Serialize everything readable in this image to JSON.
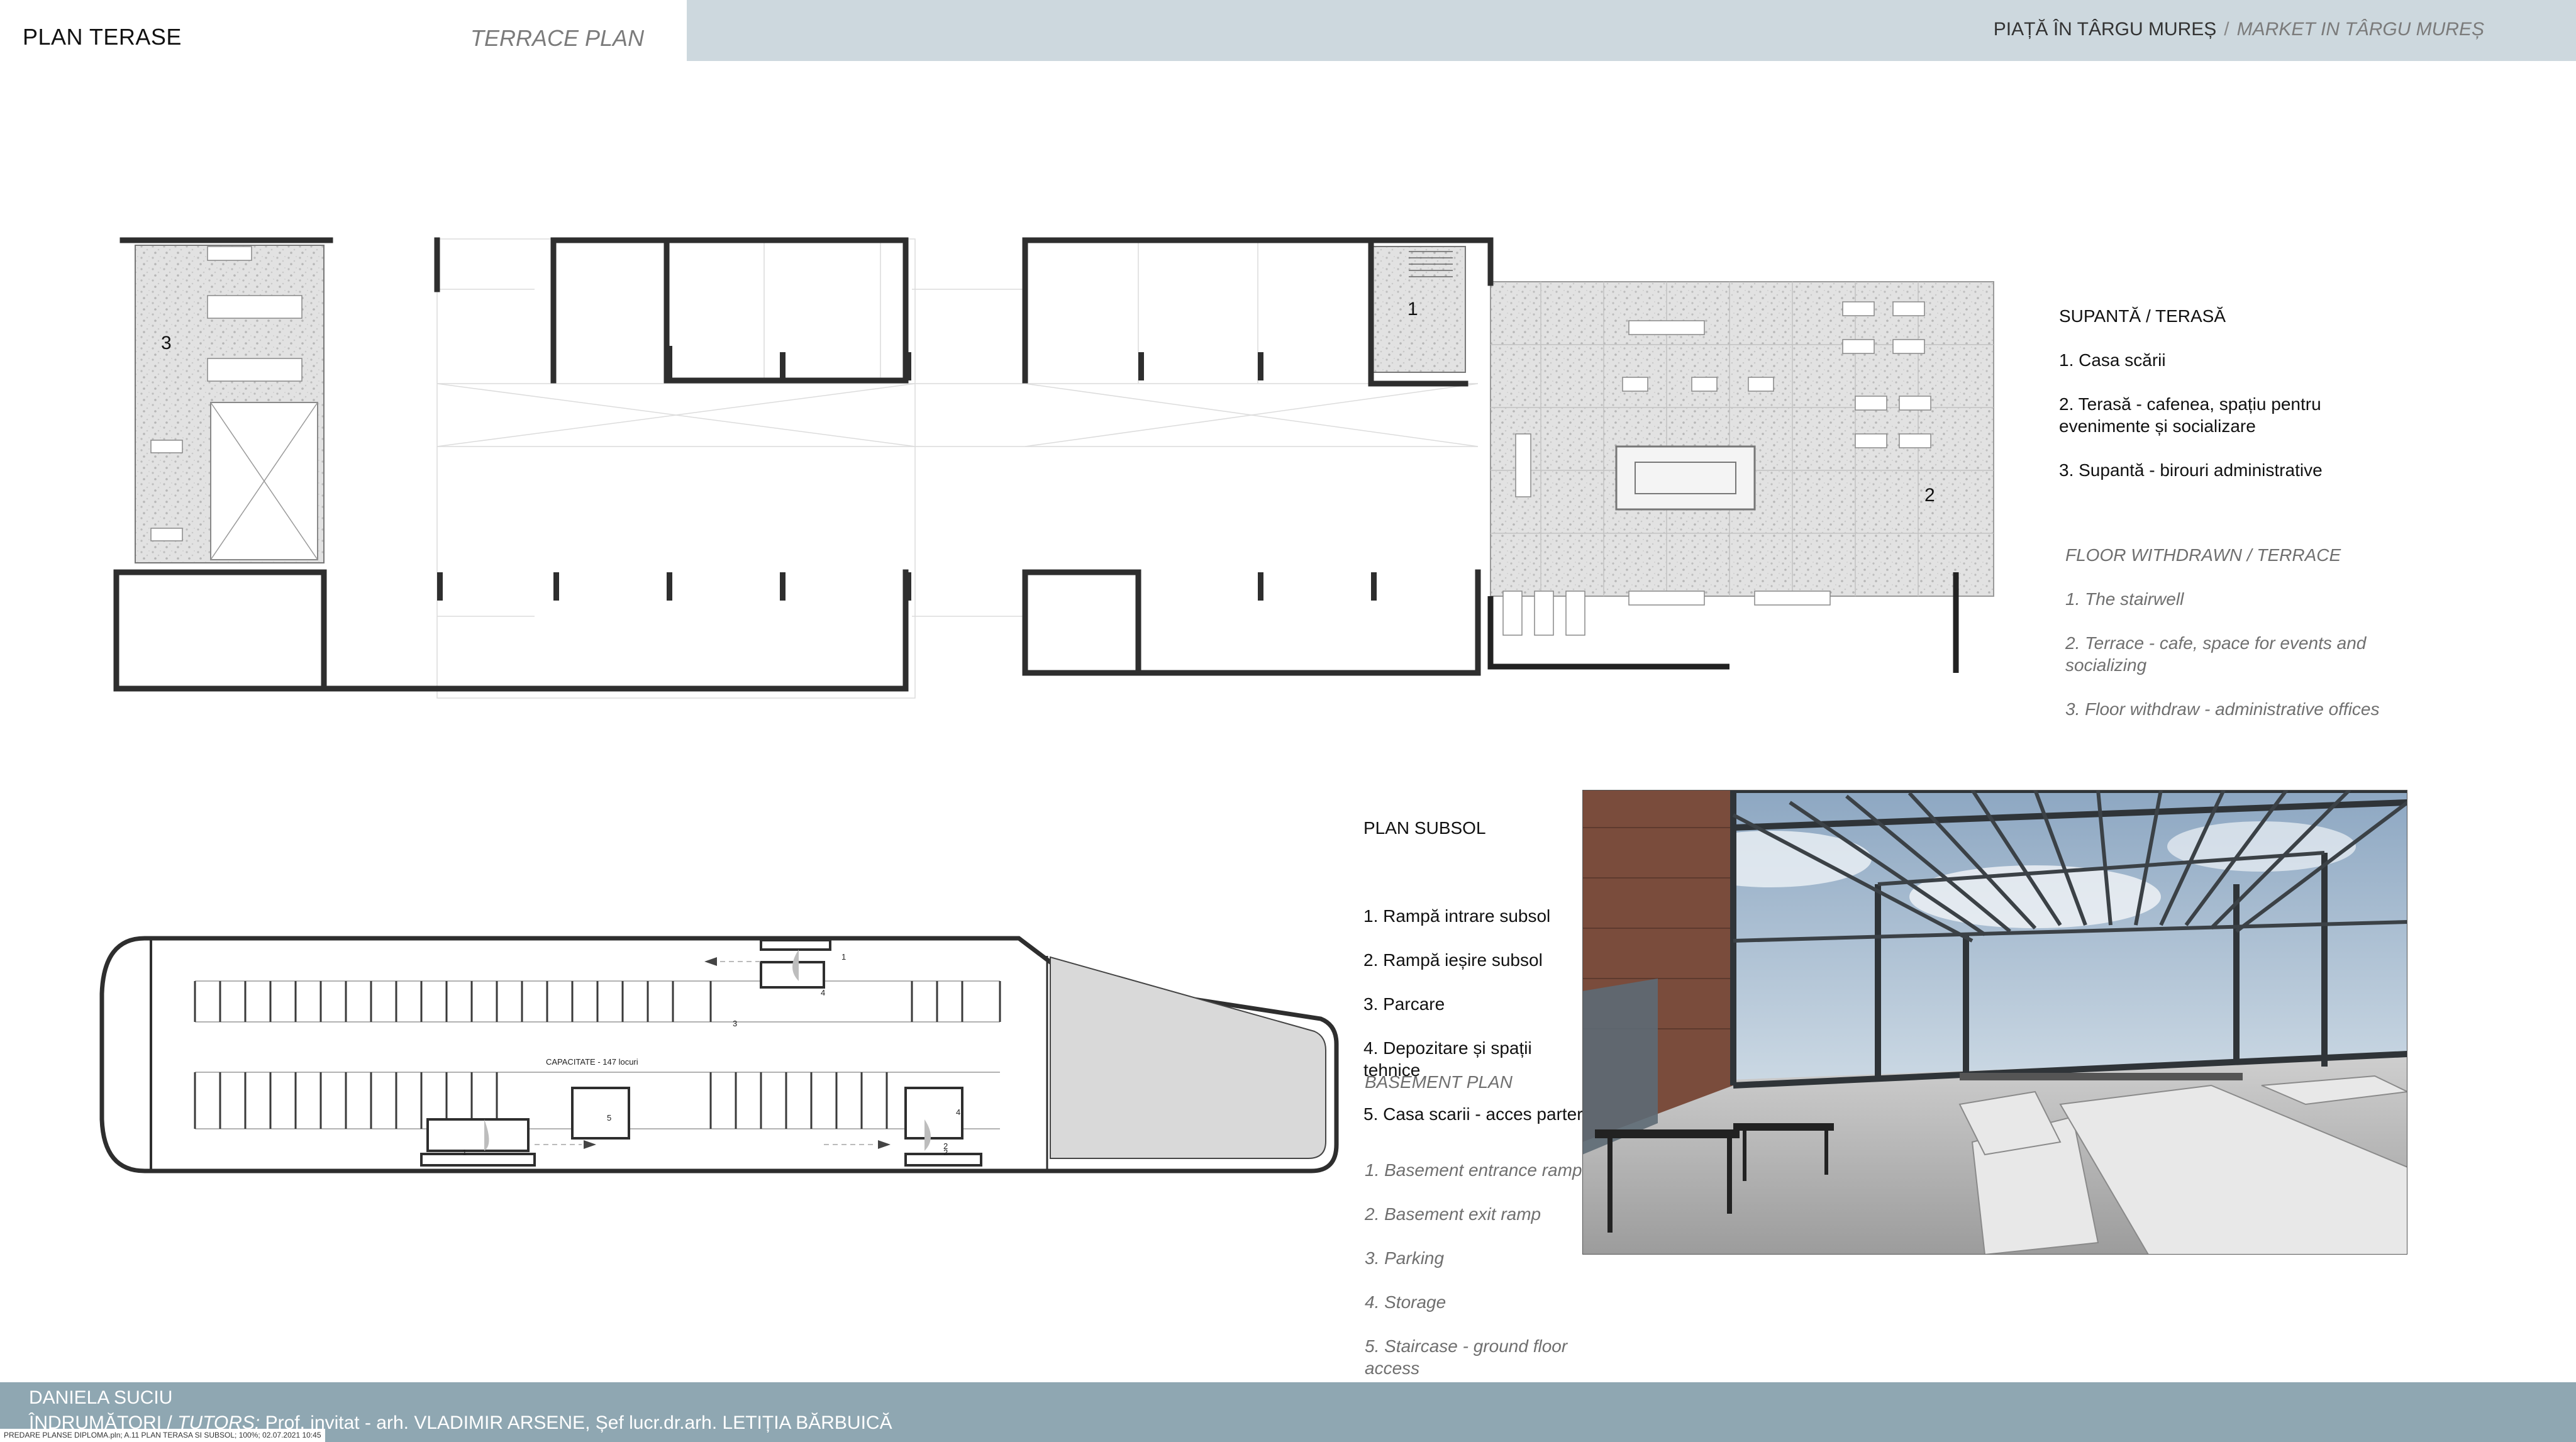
{
  "header": {
    "plan_title": "PLAN TERASE",
    "plan_title_en": "TERRACE PLAN",
    "project_ro": "PIAȚĂ ÎN TÂRGU MUREȘ",
    "project_sep": "/",
    "project_en": "MARKET IN TÂRGU MUREȘ"
  },
  "terrace_legend_ro": {
    "title": "SUPANTĂ / TERASĂ",
    "items": [
      "1.  Casa scării",
      "2. Terasă - cafenea, spațiu pentru\nevenimente și socializare",
      "3. Supantă - birouri administrative"
    ]
  },
  "terrace_legend_en": {
    "title": "FLOOR WITHDRAWN / TERRACE",
    "items": [
      "1. The stairwell",
      "2. Terrace - cafe, space for events and\nsocializing",
      "3. Floor withdraw  - administrative offices"
    ]
  },
  "basement_legend_ro": {
    "title": "PLAN SUBSOL",
    "items": [
      "1.  Rampă intrare subsol",
      "2.  Rampă ieșire subsol",
      "3.  Parcare",
      "4.  Depozitare și spații\ntehnice",
      "5.  Casa scarii  - acces parter"
    ]
  },
  "basement_legend_en": {
    "title": "BASEMENT PLAN",
    "items": [
      "1. Basement entrance ramp",
      "2. Basement exit ramp",
      "3. Parking",
      "4. Storage",
      "5. Staircase - ground floor\naccess"
    ]
  },
  "terrace_plan": {
    "labels": [
      "1",
      "2",
      "3"
    ]
  },
  "basement_plan": {
    "capacity": "CAPACITATE - 147 locuri",
    "labels": [
      "1",
      "2",
      "3",
      "4",
      "4",
      "5",
      "1",
      "2"
    ]
  },
  "footer": {
    "author": "DANIELA SUCIU",
    "tutors_label": "ÎNDRUMĂTORI / ",
    "tutors_label_en": "TUTORS:",
    "tutors": "  Prof. invitat - arh. VLADIMIR ARSENE,   Șef lucr.dr.arh. LETIȚIA BĂRBUICĂ",
    "file_info": "PREDARE PLANSE DIPLOMA.pln; A.11 PLAN TERASA SI SUBSOL; 100%; 02.07.2021 10:45"
  },
  "colors": {
    "header_band": "#cdd8de",
    "footer_band": "#8fa7b2",
    "wall": "#333333",
    "terrazzo": "#e4e4e4"
  }
}
